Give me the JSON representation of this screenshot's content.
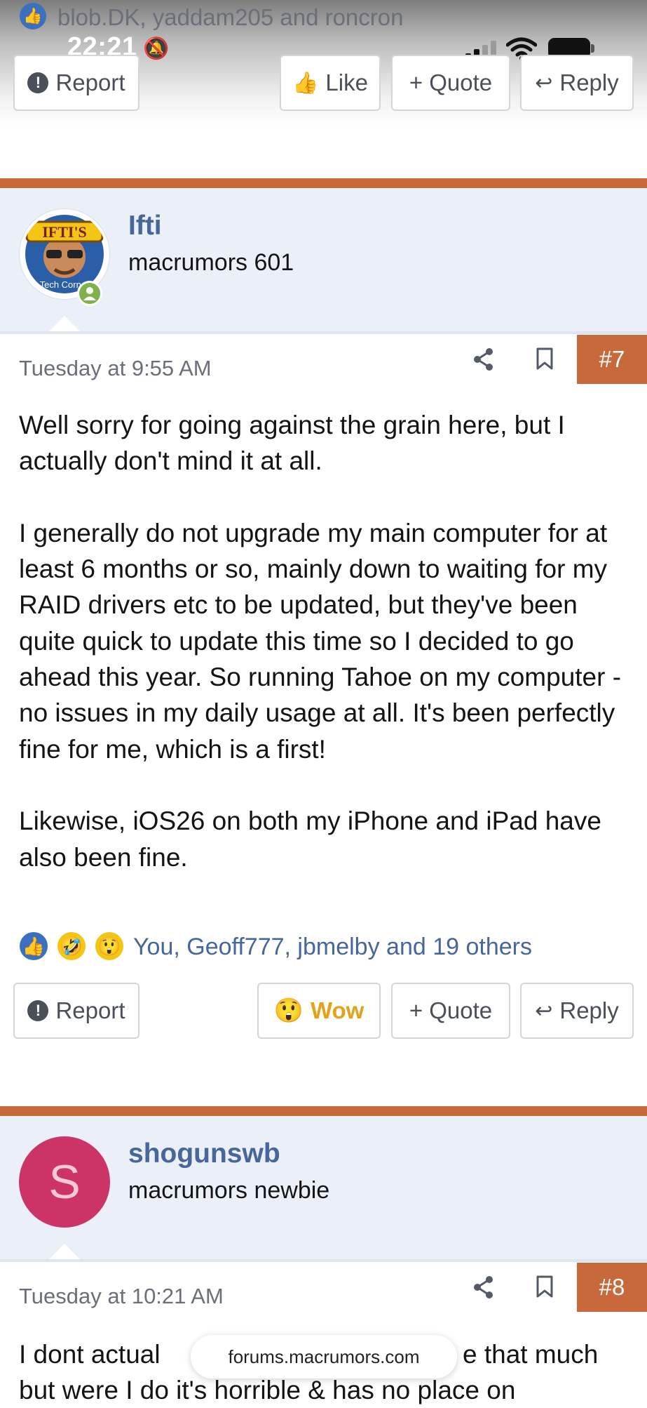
{
  "status_bar": {
    "time": "22:21"
  },
  "prev_post": {
    "reactors": "blob.DK, yaddam205 and roncron",
    "report_label": "Report",
    "like_label": "Like",
    "quote_label": "+ Quote",
    "reply_label": "Reply"
  },
  "post7": {
    "username": "Ifti",
    "user_title": "macrumors 601",
    "avatar_text": "IFTI'S",
    "avatar_subtext": "Tech Corner",
    "date": "Tuesday at 9:55 AM",
    "post_number": "#7",
    "paragraphs": [
      "Well sorry for going against the grain here, but I actually don't mind it at all.",
      "I generally do not upgrade my main computer for at least 6 months or so, mainly down to waiting for my RAID drivers etc to be updated, but they've been quite quick to update this time so I decided to go ahead this year. So running Tahoe on my computer - no issues in my daily usage at all. It's been perfectly fine for me, which is a first!",
      "Likewise, iOS26 on both my iPhone and iPad have also been fine."
    ],
    "reactors": "You, Geoff777, jbmelby and 19 others",
    "report_label": "Report",
    "wow_label": "Wow",
    "quote_label": "+ Quote",
    "reply_label": "Reply"
  },
  "post8": {
    "username": "shogunswb",
    "user_title": "macrumors newbie",
    "avatar_letter": "S",
    "date": "Tuesday at 10:21 AM",
    "post_number": "#8",
    "body_line1_left": "I dont actual",
    "body_line1_right": "e that much",
    "body_line2": "but were I do it's horrible & has no place on"
  },
  "browser": {
    "url": "forums.macrumors.com"
  },
  "colors": {
    "accent": "#c8693c",
    "link": "#47669a",
    "band": "#ebf0f8",
    "avatar_s": "#cc3366"
  }
}
